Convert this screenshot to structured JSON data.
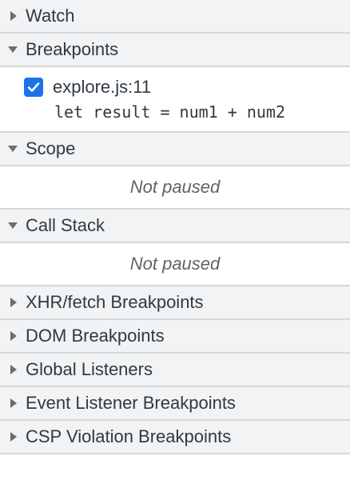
{
  "sections": {
    "watch": {
      "title": "Watch",
      "expanded": false
    },
    "breakpoints": {
      "title": "Breakpoints",
      "expanded": true,
      "items": [
        {
          "file": "explore.js:11",
          "code": "let result = num1 + num2",
          "checked": true
        }
      ]
    },
    "scope": {
      "title": "Scope",
      "expanded": true,
      "status": "Not paused"
    },
    "call_stack": {
      "title": "Call Stack",
      "expanded": true,
      "status": "Not paused"
    },
    "xhr": {
      "title": "XHR/fetch Breakpoints",
      "expanded": false
    },
    "dom": {
      "title": "DOM Breakpoints",
      "expanded": false
    },
    "global_listeners": {
      "title": "Global Listeners",
      "expanded": false
    },
    "event_listener": {
      "title": "Event Listener Breakpoints",
      "expanded": false
    },
    "csp": {
      "title": "CSP Violation Breakpoints",
      "expanded": false
    }
  },
  "colors": {
    "header_bg": "#f1f3f4",
    "divider": "#d8d8d8",
    "checkbox": "#1a73e8",
    "text": "#303942",
    "muted": "#5f6368"
  },
  "icons": {
    "collapsed": "triangle-right-icon",
    "expanded": "triangle-down-icon",
    "checkbox": "checkmark-icon"
  }
}
